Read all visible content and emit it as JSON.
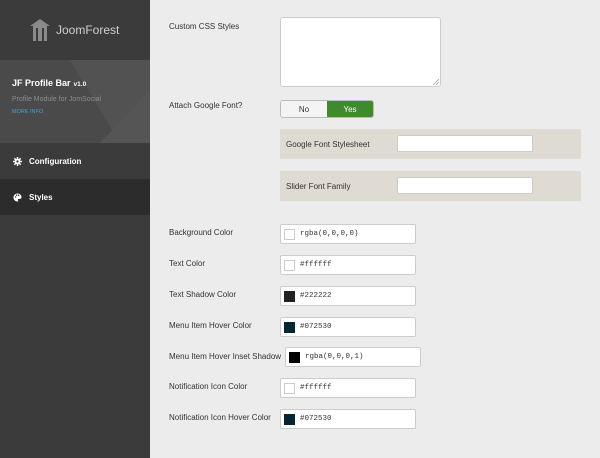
{
  "sidebar": {
    "logo_text": "JoomForest",
    "module_title": "JF Profile Bar",
    "module_version": "v1.0",
    "module_subtitle": "Profile Module for JomSocial",
    "more_info": "MORE INFO",
    "nav": [
      {
        "label": "Configuration",
        "icon": "gear-icon"
      },
      {
        "label": "Styles",
        "icon": "palette-icon"
      }
    ]
  },
  "main": {
    "custom_css_label": "Custom CSS Styles",
    "custom_css_value": "",
    "attach_font_label": "Attach Google Font?",
    "toggle": {
      "no": "No",
      "yes": "Yes",
      "selected": "Yes"
    },
    "font_stylesheet_label": "Google Font Stylesheet",
    "font_stylesheet_value": "",
    "slider_font_label": "Slider Font Family",
    "slider_font_value": "",
    "colors": [
      {
        "label": "Background Color",
        "value": "rgba(0,0,0,0)",
        "swatch": "#ffffff"
      },
      {
        "label": "Text Color",
        "value": "#ffffff",
        "swatch": "#ffffff"
      },
      {
        "label": "Text Shadow Color",
        "value": "#222222",
        "swatch": "#222222"
      },
      {
        "label": "Menu Item Hover Color",
        "value": "#072530",
        "swatch": "#072530"
      },
      {
        "label": "Menu Item Hover Inset Shadow",
        "value": "rgba(0,0,0,1)",
        "swatch": "#000000"
      },
      {
        "label": "Notification Icon Color",
        "value": "#ffffff",
        "swatch": "#ffffff"
      },
      {
        "label": "Notification Icon Hover Color",
        "value": "#072530",
        "swatch": "#072530"
      }
    ]
  },
  "colors": {
    "accent_green": "#3f8a2f",
    "sidebar_bg": "#3b3b3b",
    "panel_bg": "#dfdad2"
  }
}
